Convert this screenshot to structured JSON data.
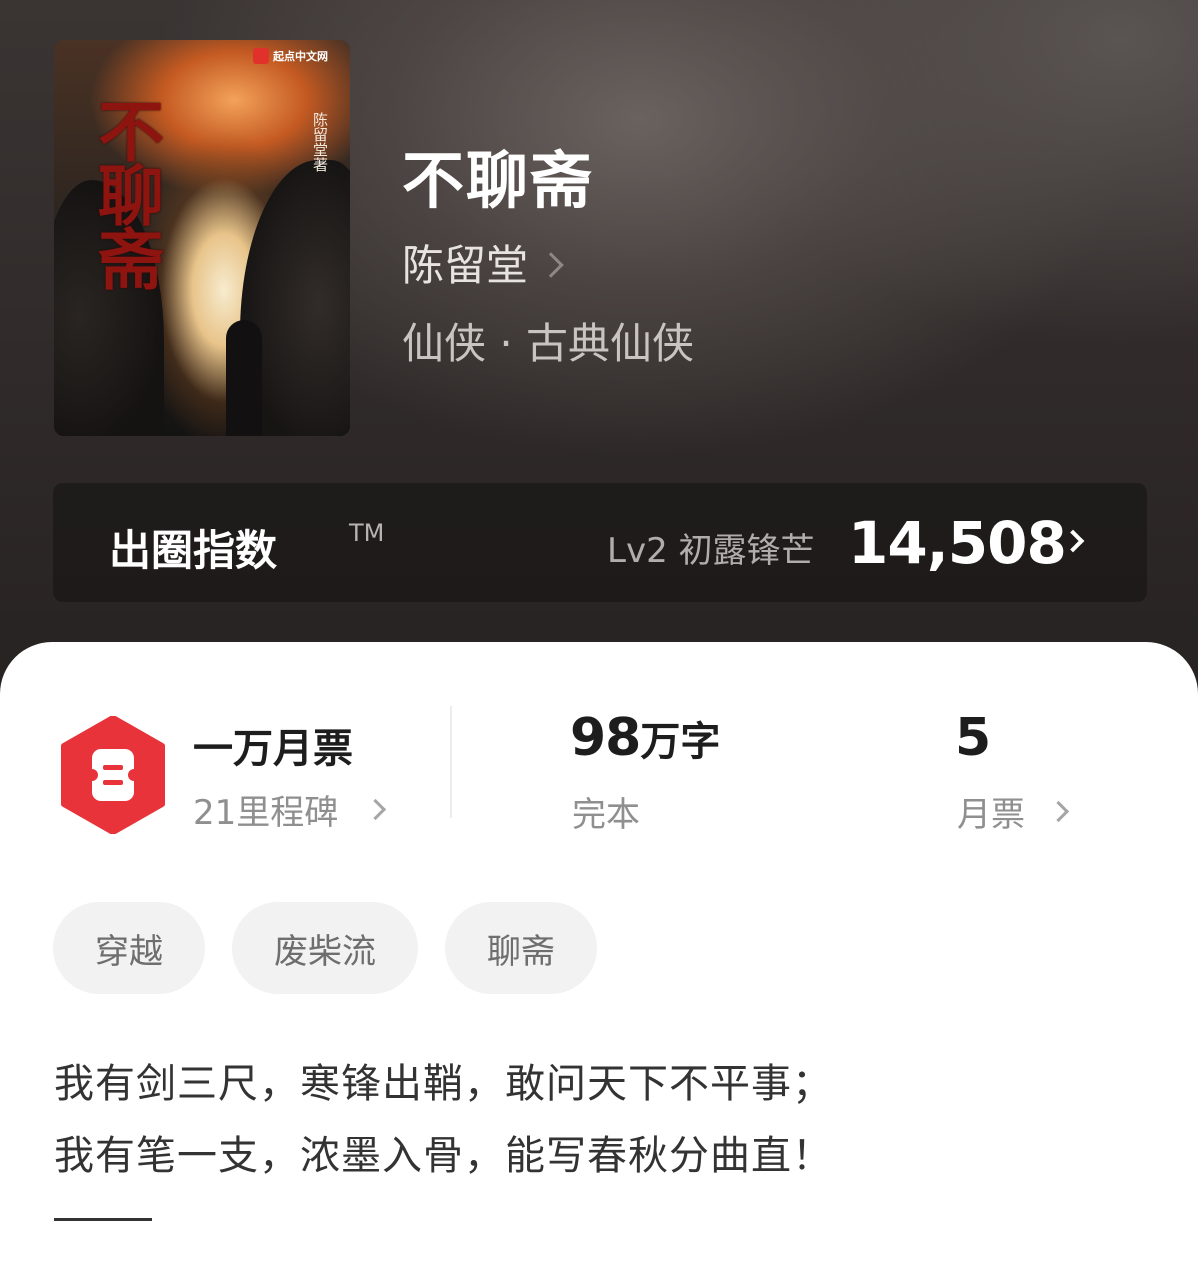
{
  "book": {
    "title": "不聊斋",
    "author": "陈留堂",
    "genre": "仙侠 · 古典仙侠",
    "cover": {
      "title_art": "不聊斋",
      "author_vertical": "陈留堂著",
      "publisher": "起点中文网"
    }
  },
  "index_bar": {
    "label": "出圈指数",
    "tm": "TM",
    "level": "Lv2 初露锋芒",
    "value": "14,508"
  },
  "stats": {
    "tickets_title": "一万月票",
    "milestones": "21里程碑",
    "word_count_num": "98",
    "word_count_unit": "万字",
    "status": "完本",
    "monthly_votes_value": "5",
    "monthly_votes_label": "月票"
  },
  "tags": [
    "穿越",
    "废柴流",
    "聊斋"
  ],
  "description": {
    "line1": "我有剑三尺，寒锋出鞘，敢问天下不平事；",
    "line2": "我有笔一支，浓墨入骨，能写春秋分曲直！"
  },
  "colors": {
    "accent_red": "#e8333a",
    "header_dark": "#2f2a29"
  }
}
